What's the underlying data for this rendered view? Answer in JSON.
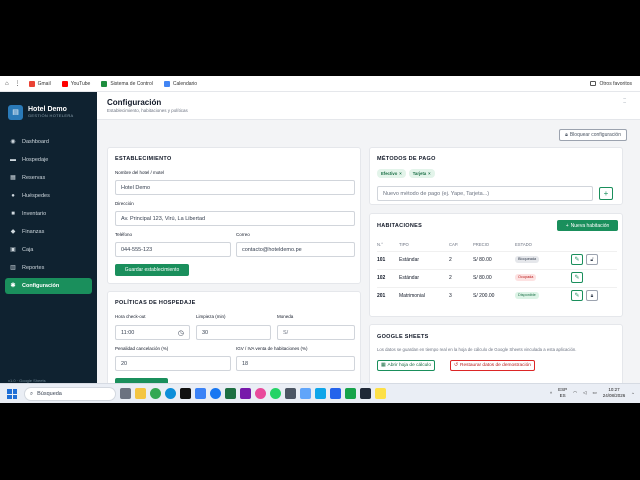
{
  "bookmarks": {
    "items": [
      {
        "label": "Gmail",
        "color": "#ea4335"
      },
      {
        "label": "YouTube",
        "color": "#ff0000"
      },
      {
        "label": "Sistema de Control",
        "color": "#1e8e3e"
      },
      {
        "label": "Calendario",
        "color": "#4285f4"
      }
    ],
    "other": "Otros favoritos"
  },
  "sidebar": {
    "app_name": "Hotel Demo",
    "app_sub": "GESTIÓN HOTELERA",
    "items": [
      {
        "label": "Dashboard",
        "icon": "dashboard-icon"
      },
      {
        "label": "Hospedaje",
        "icon": "bed-icon"
      },
      {
        "label": "Reservas",
        "icon": "calendar-icon"
      },
      {
        "label": "Huéspedes",
        "icon": "users-icon"
      },
      {
        "label": "Inventario",
        "icon": "box-icon"
      },
      {
        "label": "Finanzas",
        "icon": "money-icon"
      },
      {
        "label": "Caja",
        "icon": "cash-icon"
      },
      {
        "label": "Reportes",
        "icon": "report-icon"
      },
      {
        "label": "Configuración",
        "icon": "gear-icon",
        "active": true
      }
    ],
    "footer": "v1.0 · Google Sheets"
  },
  "header": {
    "title": "Configuración",
    "subtitle": "Establecimiento, habitaciones y políticas",
    "lock_label": "Bloquear configuración"
  },
  "establishment": {
    "title": "ESTABLECIMIENTO",
    "name_label": "Nombre del hotel / motel",
    "name_value": "Hotel Demo",
    "address_label": "Dirección",
    "address_value": "Av. Principal 123, Virú, La Libertad",
    "phone_label": "Teléfono",
    "phone_value": "044-555-123",
    "email_label": "Correo",
    "email_value": "contacto@hoteldemo.pe",
    "save_label": "Guardar establecimiento"
  },
  "policies": {
    "title": "POLÍTICAS DE HOSPEDAJE",
    "checkout_label": "Hora check-out",
    "checkout_value": "11:00",
    "cleaning_label": "Limpieza (min)",
    "cleaning_value": "30",
    "currency_label": "Moneda",
    "currency_value": "S/",
    "penalty_label": "Penalidad cancelación (%)",
    "penalty_value": "20",
    "igv_label": "IGV / IVA venta de habitaciones (%)",
    "igv_value": "18"
  },
  "payments": {
    "title": "MÉTODOS DE PAGO",
    "chips": [
      "Efectivo",
      "Tarjeta"
    ],
    "placeholder": "Nuevo método de pago (ej. Yape, Tarjeta...)"
  },
  "rooms": {
    "title": "HABITACIONES",
    "new_label": "Nueva habitación",
    "headers": [
      "N.°",
      "TIPO",
      "CAP.",
      "PRECIO",
      "ESTADO"
    ],
    "rows": [
      {
        "num": "101",
        "type": "Estándar",
        "cap": "2",
        "price": "S/ 80.00",
        "status": "Bloqueada",
        "bg": "#e5e7eb",
        "fg": "#374151"
      },
      {
        "num": "102",
        "type": "Estándar",
        "cap": "2",
        "price": "S/ 80.00",
        "status": "Ocupada",
        "bg": "#fde2e2",
        "fg": "#b91c1c"
      },
      {
        "num": "201",
        "type": "Matrimonial",
        "cap": "3",
        "price": "S/ 200.00",
        "status": "Disponible",
        "bg": "#dcf3e6",
        "fg": "#1a6e45"
      }
    ]
  },
  "sheets": {
    "title": "GOOGLE SHEETS",
    "text": "Los datos se guardan en tiempo real en la hoja de cálculo de Google Sheets vinculada a esta aplicación.",
    "open_label": "Abrir hoja de cálculo",
    "reset_label": "Restaurar datos de demostración"
  },
  "taskbar": {
    "search": "Búsqueda",
    "lang1": "ESP",
    "lang2": "ES",
    "time": "10:27",
    "date": "24/08/2026"
  },
  "colors": {
    "accent": "#1a8f5c",
    "sidebar_bg": "#0f2230"
  }
}
